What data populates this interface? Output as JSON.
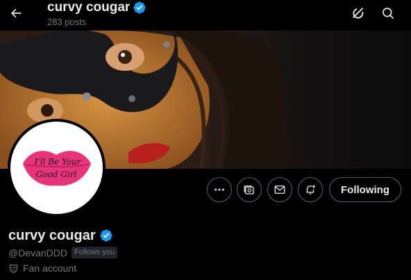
{
  "header": {
    "name": "curvy cougar",
    "posts_count": "283 posts",
    "icons": [
      "back-arrow-icon",
      "grok-icon",
      "search-icon"
    ]
  },
  "avatar": {
    "text_line1": "I'll Be Your",
    "text_line2": "Good Girl",
    "lips_color": "#e8347a"
  },
  "actions": {
    "more_icon": "more-icon",
    "subscribe_icon": "subscribe-icon",
    "message_icon": "message-icon",
    "notify_icon": "notify-bell-icon",
    "follow_label": "Following"
  },
  "profile": {
    "name": "curvy cougar",
    "handle": "@DevanDDD",
    "follows_you": "Follows you",
    "category": "Fan account",
    "verified_color": "#1d9bf0"
  }
}
